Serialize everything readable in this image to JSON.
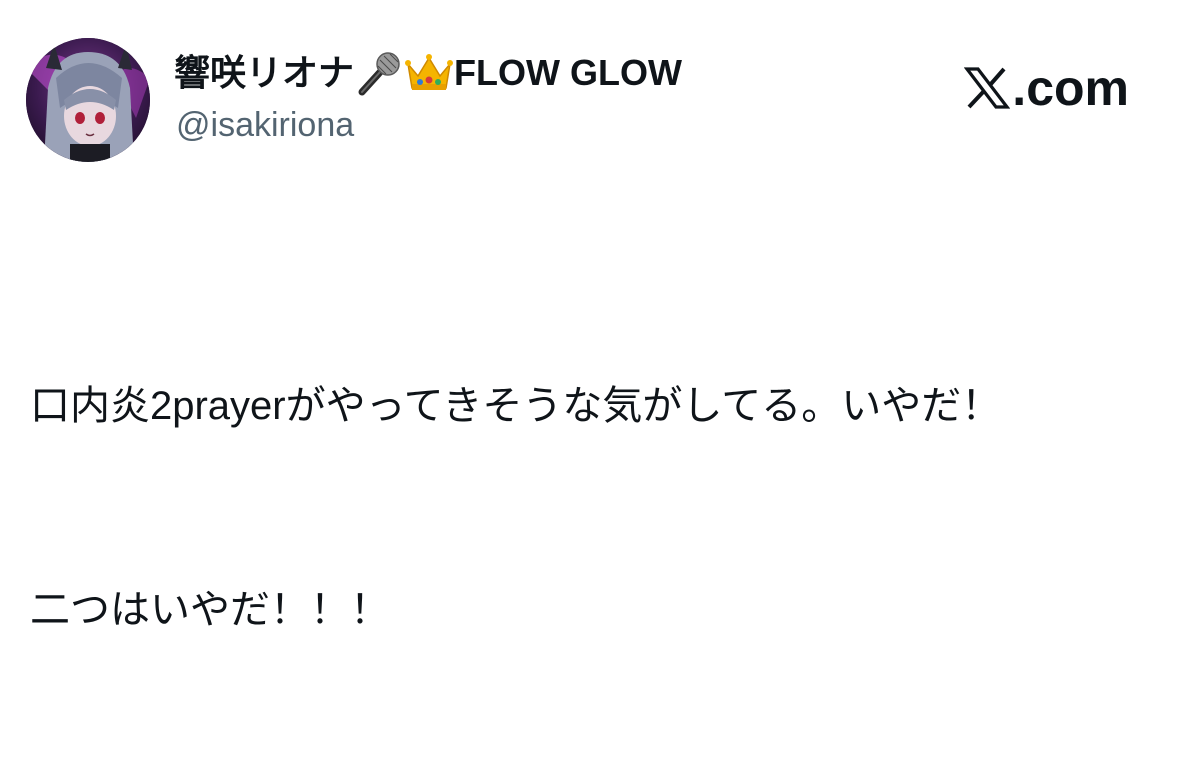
{
  "author": {
    "display_name_text": "響咲リオナ",
    "display_name_suffix": "FLOW GLOW",
    "emojis": [
      "microphone-icon",
      "crown-icon"
    ],
    "handle": "@isakiriona"
  },
  "brand": {
    "label": ".com",
    "logo_icon": "x-logo-icon"
  },
  "tweet": {
    "lines": [
      "口内炎2prayerがやってきそうな気がしてる。いやだ！",
      "二つはいやだ！！！"
    ]
  },
  "colors": {
    "text": "#0f1419",
    "secondary_text": "#536471",
    "background": "#ffffff"
  }
}
